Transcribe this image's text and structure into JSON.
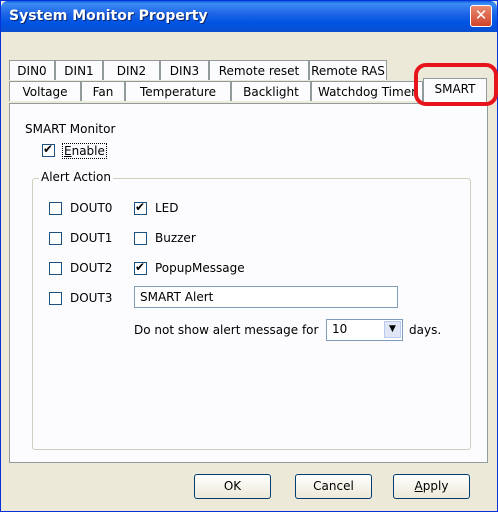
{
  "window": {
    "title": "System Monitor Property",
    "close_glyph": "✕"
  },
  "tabs_top": [
    "DIN0",
    "DIN1",
    "DIN2",
    "DIN3",
    "Remote reset",
    "Remote RAS"
  ],
  "tabs_bottom": [
    "Voltage",
    "Fan",
    "Temperature",
    "Backlight",
    "Watchdog Timer",
    "SMART"
  ],
  "active_tab": "SMART",
  "smart": {
    "section_label": "SMART Monitor",
    "enable_label": "Enable",
    "enable_checked": true
  },
  "alert": {
    "group_label": "Alert Action",
    "dout": [
      {
        "label": "DOUT0",
        "checked": false
      },
      {
        "label": "DOUT1",
        "checked": false
      },
      {
        "label": "DOUT2",
        "checked": false
      },
      {
        "label": "DOUT3",
        "checked": false
      }
    ],
    "actions": [
      {
        "label": "LED",
        "checked": true
      },
      {
        "label": "Buzzer",
        "checked": false
      },
      {
        "label": "PopupMessage",
        "checked": true
      }
    ],
    "message_value": "SMART Alert",
    "suppress_label": "Do not show alert message for",
    "suppress_value": "10",
    "suppress_unit": "days."
  },
  "buttons": {
    "ok": "OK",
    "cancel": "Cancel",
    "apply": "Apply"
  },
  "colors": {
    "title_bar": "#0054e3",
    "close_button": "#d1432a",
    "highlight": "#e8141b"
  }
}
